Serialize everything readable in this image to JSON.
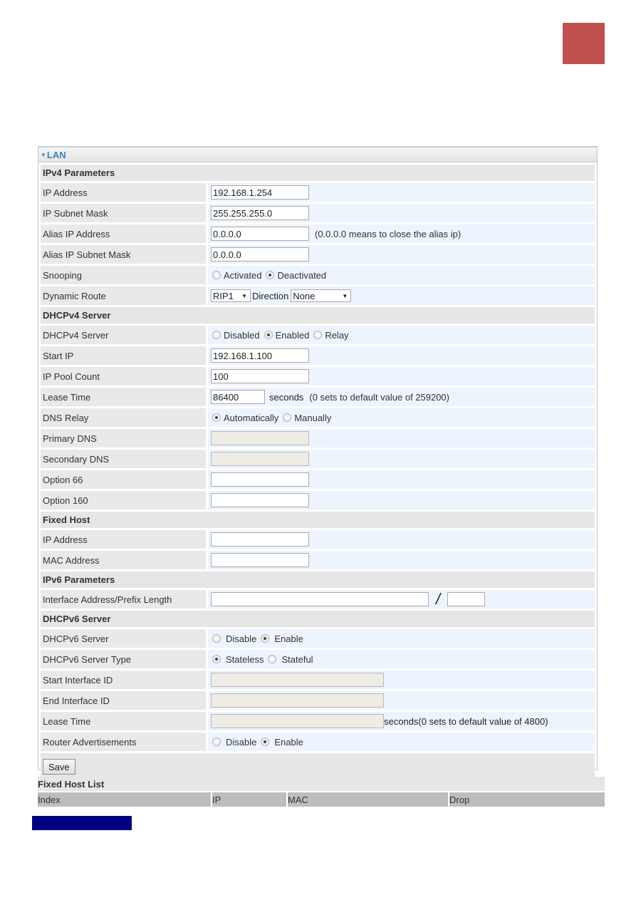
{
  "panel": {
    "title": "LAN",
    "sections": {
      "ipv4": "IPv4 Parameters",
      "dhcpv4": "DHCPv4 Server",
      "fixed_host": "Fixed Host",
      "ipv6": "IPv6 Parameters",
      "dhcpv6": "DHCPv6 Server"
    },
    "ipv4": {
      "ip_address": {
        "label": "IP Address",
        "value": "192.168.1.254"
      },
      "subnet_mask": {
        "label": "IP Subnet Mask",
        "value": "255.255.255.0"
      },
      "alias_ip": {
        "label": "Alias IP Address",
        "value": "0.0.0.0",
        "note": "(0.0.0.0 means to close the alias ip)"
      },
      "alias_mask": {
        "label": "Alias IP Subnet Mask",
        "value": "0.0.0.0"
      },
      "snooping": {
        "label": "Snooping",
        "options": [
          "Activated",
          "Deactivated"
        ],
        "selected": "Deactivated"
      },
      "dynamic_route": {
        "label": "Dynamic Route",
        "rip_value": "RIP1",
        "direction_label": "Direction",
        "direction_value": "None"
      }
    },
    "dhcpv4": {
      "server": {
        "label": "DHCPv4 Server",
        "options": [
          "Disabled",
          "Enabled",
          "Relay"
        ],
        "selected": "Enabled"
      },
      "start_ip": {
        "label": "Start IP",
        "value": "192.168.1.100"
      },
      "pool_count": {
        "label": "IP Pool Count",
        "value": "100"
      },
      "lease_time": {
        "label": "Lease Time",
        "value": "86400",
        "unit": "seconds",
        "note": "(0 sets to default value of 259200)"
      },
      "dns_relay": {
        "label": "DNS Relay",
        "options": [
          "Automatically",
          "Manually"
        ],
        "selected": "Automatically"
      },
      "primary_dns": {
        "label": "Primary DNS",
        "value": ""
      },
      "secondary_dns": {
        "label": "Secondary DNS",
        "value": ""
      },
      "option66": {
        "label": "Option 66",
        "value": ""
      },
      "option160": {
        "label": "Option 160",
        "value": ""
      }
    },
    "fixed_host": {
      "ip_address": {
        "label": "IP Address",
        "value": ""
      },
      "mac_address": {
        "label": "MAC Address",
        "value": ""
      }
    },
    "ipv6": {
      "interface": {
        "label": "Interface Address/Prefix Length",
        "address": "",
        "separator": "/",
        "prefix": ""
      }
    },
    "dhcpv6": {
      "server": {
        "label": "DHCPv6 Server",
        "options": [
          "Disable",
          "Enable"
        ],
        "selected": "Enable"
      },
      "server_type": {
        "label": "DHCPv6 Server Type",
        "options": [
          "Stateless",
          "Stateful"
        ],
        "selected": "Stateless"
      },
      "start_id": {
        "label": "Start Interface ID",
        "value": ""
      },
      "end_id": {
        "label": "End Interface ID",
        "value": ""
      },
      "lease_time": {
        "label": "Lease Time",
        "value": "",
        "note": "seconds(0 sets to default value of 4800)"
      },
      "router_adv": {
        "label": "Router Advertisements",
        "options": [
          "Disable",
          "Enable"
        ],
        "selected": "Enable"
      }
    },
    "save_label": "Save"
  },
  "fixed_host_list": {
    "title": "Fixed Host List",
    "columns": [
      "Index",
      "IP",
      "MAC",
      "Drop"
    ]
  },
  "colors": {
    "accent_block": "#c0504d",
    "title_blue": "#3a82c4",
    "nav_bar": "#000080"
  }
}
